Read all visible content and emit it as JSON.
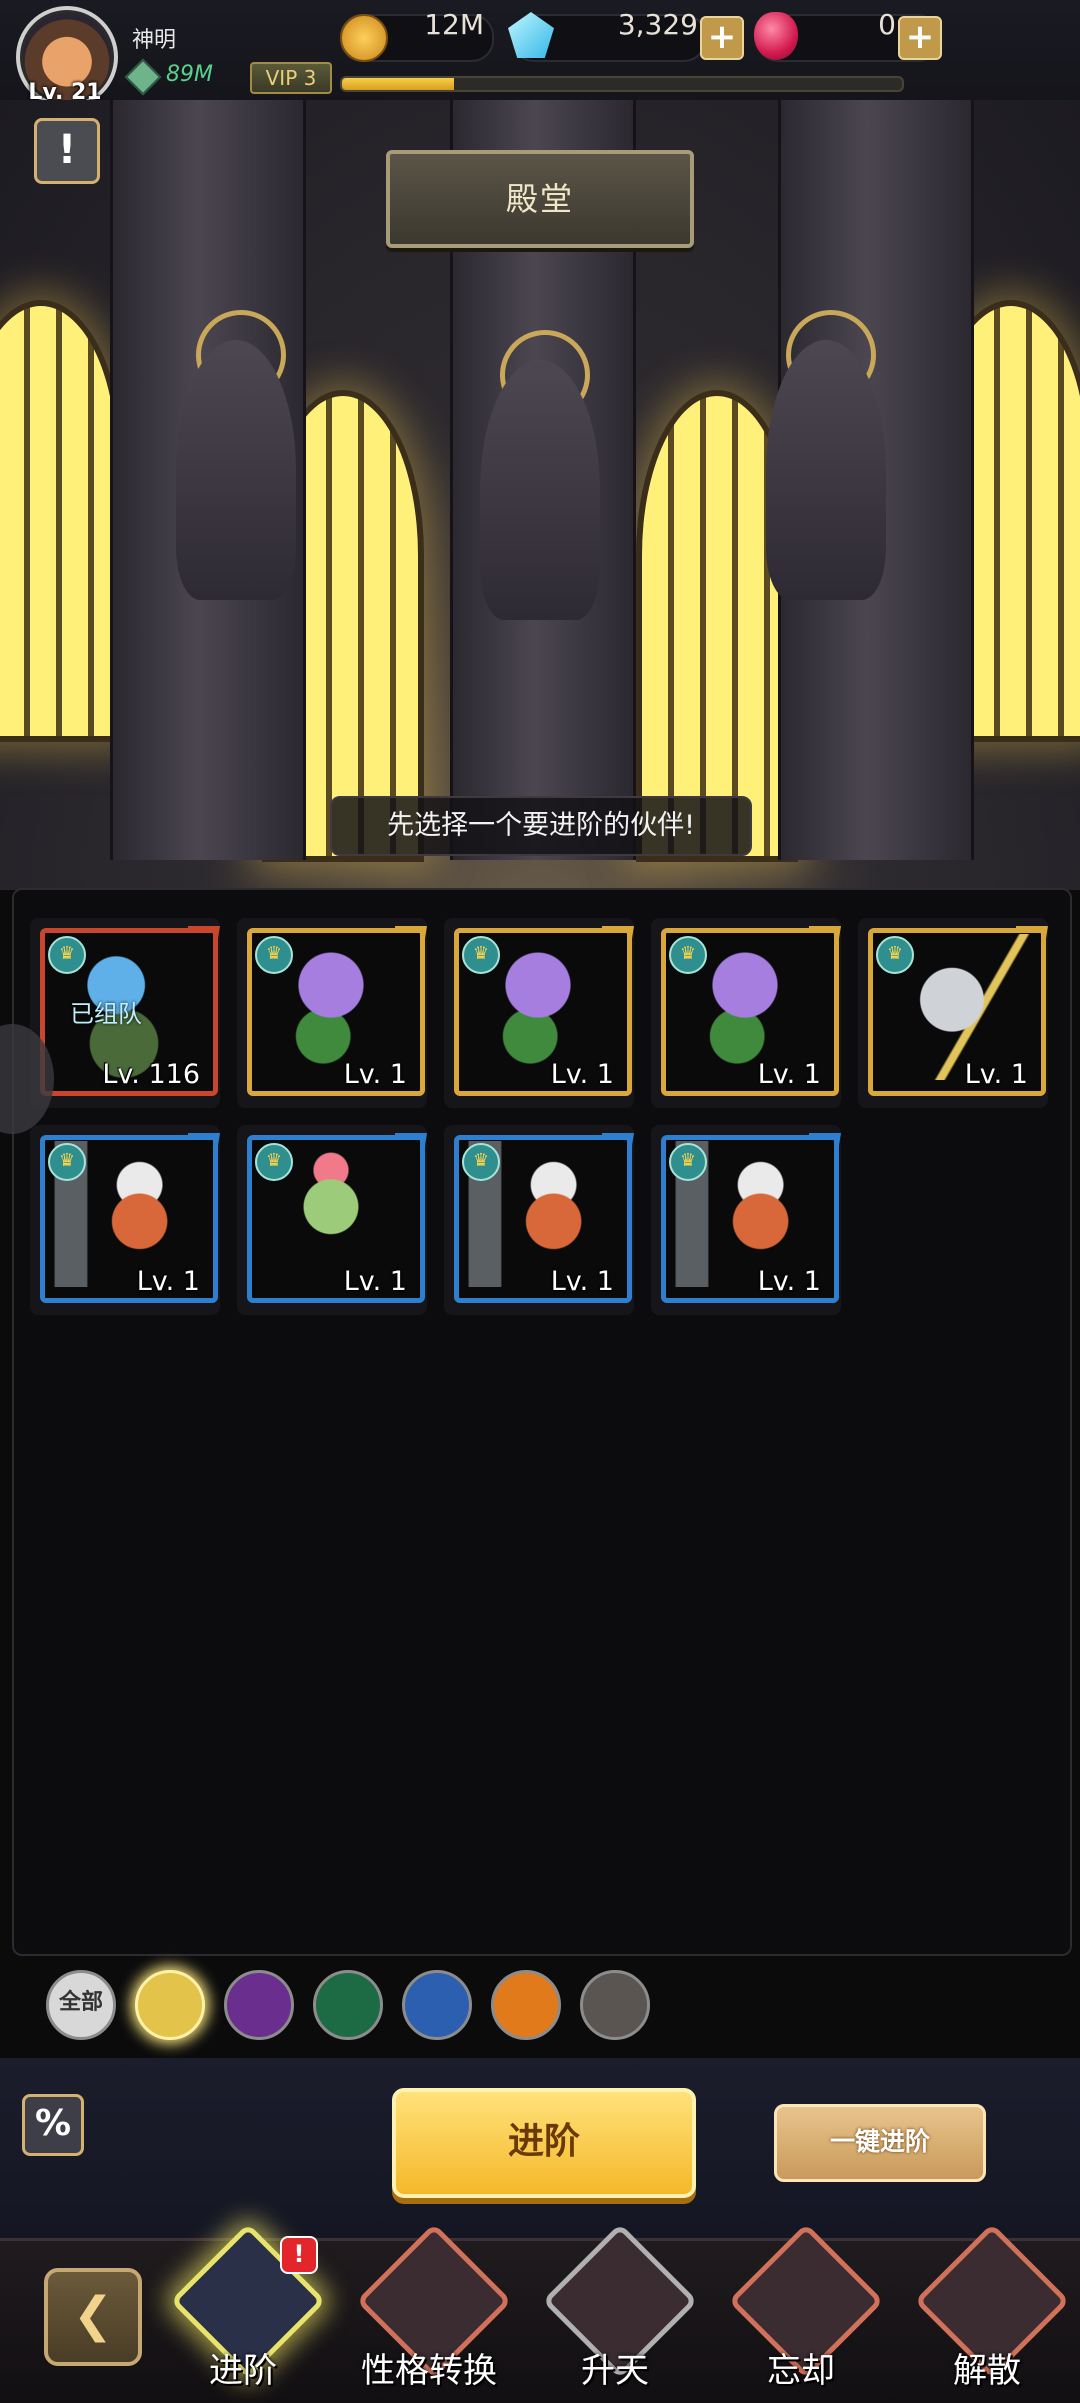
{
  "player": {
    "level": "Lv. 21",
    "name": "神明",
    "power": "89M",
    "vip": "VIP 3",
    "vip_progress": 0.2
  },
  "currencies": {
    "gold": "12M",
    "gems": "3,329",
    "rubies": "0"
  },
  "scene": {
    "title": "殿堂",
    "hint": "先选择一个要进阶的伙伴!"
  },
  "heroes": [
    {
      "level": "Lv. 116",
      "tag": "已组队",
      "frame": "#c8462c",
      "art": "blue-helmet-knight"
    },
    {
      "level": "Lv. 1",
      "tag": "",
      "frame": "#d9a73a",
      "art": "purple-flower"
    },
    {
      "level": "Lv. 1",
      "tag": "",
      "frame": "#d9a73a",
      "art": "purple-flower"
    },
    {
      "level": "Lv. 1",
      "tag": "",
      "frame": "#d9a73a",
      "art": "purple-flower"
    },
    {
      "level": "Lv. 1",
      "tag": "",
      "frame": "#d9a73a",
      "art": "silver-helmet"
    },
    {
      "level": "Lv. 1",
      "tag": "",
      "frame": "#2f7fd0",
      "art": "miner-girl"
    },
    {
      "level": "Lv. 1",
      "tag": "",
      "frame": "#2f7fd0",
      "art": "flower-bud"
    },
    {
      "level": "Lv. 1",
      "tag": "",
      "frame": "#2f7fd0",
      "art": "miner-girl"
    },
    {
      "level": "Lv. 1",
      "tag": "",
      "frame": "#2f7fd0",
      "art": "miner-girl"
    }
  ],
  "filters": [
    {
      "label": "全部",
      "icon": "all-icon",
      "color": "#d8d8d8"
    },
    {
      "label": "",
      "icon": "crown-icon",
      "color": "#e3c34a"
    },
    {
      "label": "",
      "icon": "spikes-icon",
      "color": "#6a2e8e"
    },
    {
      "label": "",
      "icon": "tree-icon",
      "color": "#1d6b45"
    },
    {
      "label": "",
      "icon": "anchor-icon",
      "color": "#2d5fb0"
    },
    {
      "label": "",
      "icon": "dragon-icon",
      "color": "#e07a1a"
    },
    {
      "label": "",
      "icon": "mask-icon",
      "color": "#5a5550"
    }
  ],
  "actions": {
    "discount": "%",
    "advance": "进阶",
    "one_click": "一键进阶"
  },
  "nav": [
    {
      "label": "进阶",
      "color": "#e8e36a",
      "badge": "!"
    },
    {
      "label": "性格转换",
      "color": "#d2715a"
    },
    {
      "label": "升天",
      "color": "#b0b0b0"
    },
    {
      "label": "忘却",
      "color": "#d2715a"
    },
    {
      "label": "解散",
      "color": "#d2715a"
    }
  ],
  "alert": "!"
}
